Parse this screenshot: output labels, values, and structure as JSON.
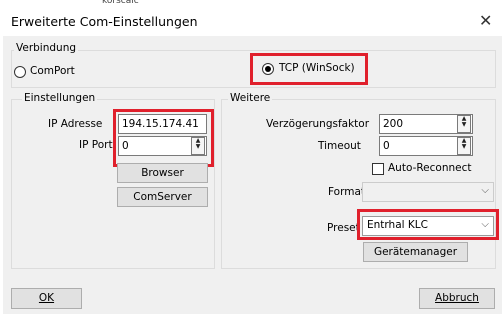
{
  "background": {
    "snippet": "korscaic"
  },
  "window": {
    "title": "Erweiterte Com-Einstellungen",
    "close_glyph": "✕"
  },
  "verbindung": {
    "label": "Verbindung",
    "comport_label": "ComPort",
    "tcp_label": "TCP (WinSock)",
    "selected": "TCP (WinSock)"
  },
  "einstellungen": {
    "label": "Einstellungen",
    "ip_label": "IP Adresse",
    "ip_value": "194.15.174.41",
    "port_label": "IP Port",
    "port_value": "0",
    "browser_label": "Browser",
    "comserver_label": "ComServer"
  },
  "weitere": {
    "label": "Weitere",
    "delay_label": "Verzögerungsfaktor",
    "delay_value": "200",
    "timeout_label": "Timeout",
    "timeout_value": "0",
    "reconnect_label": "Auto-Reconnect",
    "reconnect_checked": false,
    "format_label": "Format",
    "format_value": "",
    "preset_label": "Preset",
    "preset_value": "Entrhal KLC",
    "geraete_label": "Gerätemanager"
  },
  "footer": {
    "ok_label": "OK",
    "cancel_label": "Abbruch"
  },
  "colors": {
    "highlight": "#e0202c",
    "dialog_bg": "#f0f0f0"
  }
}
